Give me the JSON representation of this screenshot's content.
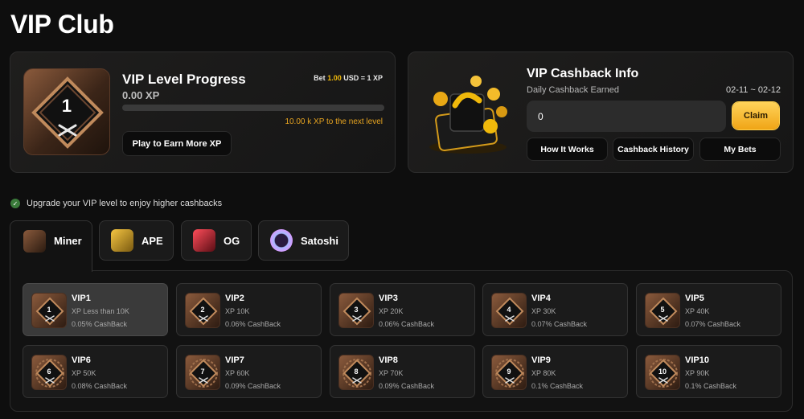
{
  "page": {
    "title": "VIP Club"
  },
  "progress": {
    "title": "VIP Level Progress",
    "xp": "0.00 XP",
    "rate_prefix": "Bet ",
    "rate_amount": "1.00",
    "rate_suffix": " USD = 1 XP",
    "next_level_text": "10.00 k XP to the next level",
    "progress_fraction": 0,
    "current_level": "1",
    "play_button": "Play to Earn More XP"
  },
  "cashback": {
    "title": "VIP Cashback Info",
    "subtitle": "Daily Cashback Earned",
    "date_range": "02-11 ~ 02-12",
    "amount_value": "0",
    "claim_button": "Claim",
    "how_it_works": "How It Works",
    "history": "Cashback History",
    "my_bets": "My Bets"
  },
  "upgrade_note": "Upgrade your VIP level to enjoy higher cashbacks",
  "tabs": [
    {
      "label": "Miner",
      "icon": "miner-icon",
      "selected": true
    },
    {
      "label": "APE",
      "icon": "ape-icon",
      "selected": false
    },
    {
      "label": "OG",
      "icon": "og-icon",
      "selected": false
    },
    {
      "label": "Satoshi",
      "icon": "satoshi-icon",
      "selected": false
    }
  ],
  "levels": [
    {
      "name": "VIP1",
      "num": "1",
      "xp": "XP Less than 10K",
      "cashback": "0.05% CashBack"
    },
    {
      "name": "VIP2",
      "num": "2",
      "xp": "XP 10K",
      "cashback": "0.06% CashBack"
    },
    {
      "name": "VIP3",
      "num": "3",
      "xp": "XP 20K",
      "cashback": "0.06% CashBack"
    },
    {
      "name": "VIP4",
      "num": "4",
      "xp": "XP 30K",
      "cashback": "0.07% CashBack"
    },
    {
      "name": "VIP5",
      "num": "5",
      "xp": "XP 40K",
      "cashback": "0.07% CashBack"
    },
    {
      "name": "VIP6",
      "num": "6",
      "xp": "XP 50K",
      "cashback": "0.08% CashBack"
    },
    {
      "name": "VIP7",
      "num": "7",
      "xp": "XP 60K",
      "cashback": "0.09% CashBack"
    },
    {
      "name": "VIP8",
      "num": "8",
      "xp": "XP 70K",
      "cashback": "0.09% CashBack"
    },
    {
      "name": "VIP9",
      "num": "9",
      "xp": "XP 80K",
      "cashback": "0.1% CashBack"
    },
    {
      "name": "VIP10",
      "num": "10",
      "xp": "XP 90K",
      "cashback": "0.1% CashBack"
    }
  ],
  "colors": {
    "accent": "#f0b90b",
    "claim": "#ffc83a",
    "background": "#0e0e0e"
  }
}
